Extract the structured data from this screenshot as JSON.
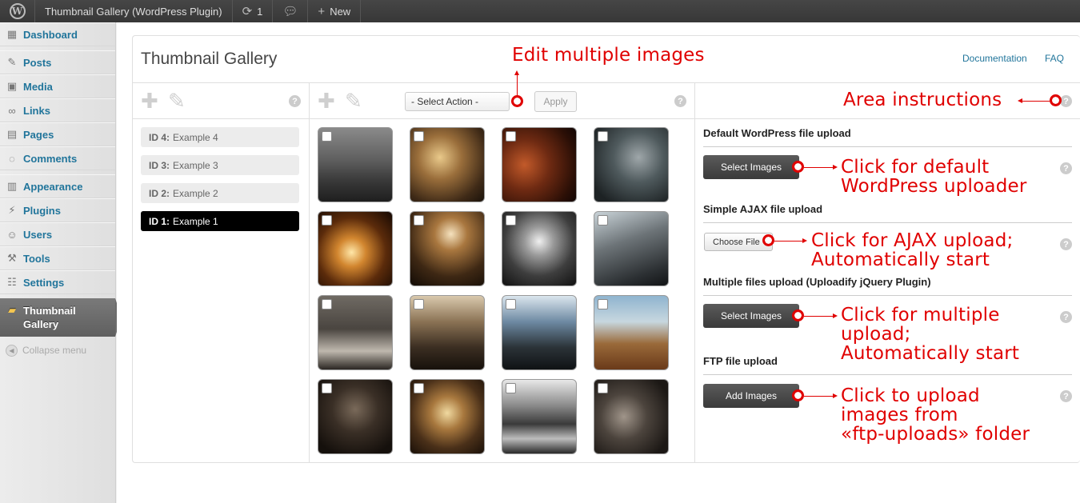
{
  "adminbar": {
    "wp_logo_icon": "wordpress-logo-icon",
    "site_title": "Thumbnail Gallery (WordPress Plugin)",
    "updates_count": "1",
    "updates_icon": "refresh-icon",
    "comments_icon": "speech-bubble-icon",
    "new_label": "New",
    "new_icon": "plus-icon"
  },
  "sidebar": {
    "items": [
      {
        "label": "Dashboard",
        "icon": "dashboard-icon"
      },
      {
        "label": "Posts",
        "icon": "pushpin-icon"
      },
      {
        "label": "Media",
        "icon": "media-icon"
      },
      {
        "label": "Links",
        "icon": "link-icon"
      },
      {
        "label": "Pages",
        "icon": "page-icon"
      },
      {
        "label": "Comments",
        "icon": "speech-bubble-icon"
      },
      {
        "label": "Appearance",
        "icon": "appearance-icon"
      },
      {
        "label": "Plugins",
        "icon": "plug-icon"
      },
      {
        "label": "Users",
        "icon": "users-icon"
      },
      {
        "label": "Tools",
        "icon": "tools-icon"
      },
      {
        "label": "Settings",
        "icon": "settings-icon"
      }
    ],
    "current": {
      "label_line1": "Thumbnail",
      "label_line2": "Gallery",
      "icon": "gallery-icon"
    },
    "collapse_label": "Collapse menu"
  },
  "main": {
    "title": "Thumbnail Gallery",
    "links": {
      "documentation": "Documentation",
      "faq": "FAQ"
    },
    "galleries": [
      {
        "id_label": "ID 4:",
        "name": "Example 4",
        "active": false
      },
      {
        "id_label": "ID 3:",
        "name": "Example 3",
        "active": false
      },
      {
        "id_label": "ID 2:",
        "name": "Example 2",
        "active": false
      },
      {
        "id_label": "ID 1:",
        "name": "Example 1",
        "active": true
      }
    ],
    "bulk": {
      "select_label": "- Select Action -",
      "apply_label": "Apply"
    },
    "help_glyph": "?",
    "upload": {
      "default_title": "Default WordPress file upload",
      "default_button": "Select Images",
      "ajax_title": "Simple AJAX file upload",
      "ajax_button": "Choose File",
      "multi_title": "Multiple files upload (Uploadify jQuery Plugin)",
      "multi_button": "Select Images",
      "ftp_title": "FTP file upload",
      "ftp_button": "Add Images"
    }
  },
  "annotations": {
    "edit_multiple": "Edit multiple images",
    "area_instructions": "Area instructions",
    "default_uploader_1": "Click for default",
    "default_uploader_2": "WordPress uploader",
    "ajax_1": "Click for AJAX upload;",
    "ajax_2": "Automatically start",
    "multi_1": "Click for multiple",
    "multi_2": "upload;",
    "multi_3": "Automatically start",
    "ftp_1": "Click to upload",
    "ftp_2": "images from",
    "ftp_3": "«ftp-uploads» folder"
  },
  "colors": {
    "accent_link": "#21759b",
    "annotation_red": "#e00000",
    "active_gallery": "#000000"
  }
}
